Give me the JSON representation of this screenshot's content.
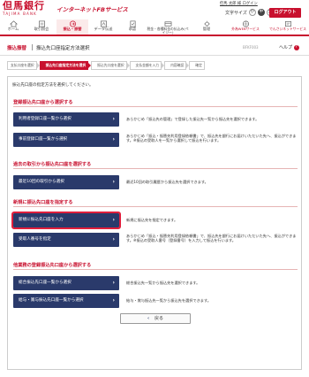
{
  "header": {
    "logo_main": "但馬銀行",
    "logo_sub": "TAJIMA BANK",
    "service_title": "インターネットFBサービス",
    "user_line": "但馬 太郎 様 ログイン",
    "font_label": "文字サイズ",
    "font_small": "小",
    "font_medium": "中",
    "font_large": "大",
    "logout_label": "ログアウト"
  },
  "nav": {
    "items": [
      {
        "label": "ホーム",
        "icon": "home-icon"
      },
      {
        "label": "取引照会",
        "icon": "inquiry-icon"
      },
      {
        "label": "振込・振替",
        "icon": "transfer-icon"
      },
      {
        "label": "データ伝送",
        "icon": "data-icon"
      },
      {
        "label": "承認",
        "icon": "approval-icon"
      },
      {
        "label": "税金・各種料金の払込み(ペイジー)",
        "icon": "payment-icon"
      },
      {
        "label": "管理",
        "icon": "admin-icon"
      },
      {
        "label": "外為WEBサービス",
        "icon": "forex-icon"
      },
      {
        "label": "でんさいネットサービス",
        "icon": "densai-icon"
      }
    ]
  },
  "title_bar": {
    "category": "振込振替",
    "title": "振込先口座指定方法選択",
    "screen_id": "BFKF003",
    "help": "ヘルプ"
  },
  "steps": [
    "支払口座を選択",
    "振込先口座指定方法を選択",
    "振込先口座を選択",
    "支払金額を入力",
    "内容確認",
    "確定"
  ],
  "intro": "振込先口座の指定方法を選択してください。",
  "sections": [
    {
      "heading": "登録振込先口座から選択する",
      "buttons": [
        {
          "label": "利用者登録口座一覧から選択",
          "desc": "あらかじめ「振込先の管理」で登録した振込先一覧から振込先を選択できます。"
        },
        {
          "label": "事前登録口座一覧から選択",
          "desc": "あらかじめ「振込・振替先利用登録依頼書」で、振込先を銀行にお届けいただいた先へ、振込ができます。※振込の受取人を一覧から選択して振込を行います。"
        }
      ]
    },
    {
      "heading": "過去の取引から振込先口座を選択する",
      "buttons": [
        {
          "label": "最近10回の取引から選択",
          "desc": "最近10回の取引履歴から振込先を選択できます。"
        }
      ]
    },
    {
      "heading": "新規に振込先口座を指定する",
      "buttons": [
        {
          "label": "新規に振込先口座を入力",
          "desc": "新規に振込先を指定できます。"
        },
        {
          "label": "受取人番号を指定",
          "desc": "あらかじめ「振込・振替先利用登録依頼書」で、振込先を銀行にお届けいただいた先へ、振込ができます。※振込の受取人番号（登録番号）を入力して振込を行います。"
        }
      ]
    },
    {
      "heading": "他業務の登録振込先口座から選択する",
      "buttons": [
        {
          "label": "総合振込先口座一覧から選択",
          "desc": "総合振込先一覧から振込先を選択できます。"
        },
        {
          "label": "給与・賞与振込先口座一覧から選択",
          "desc": "給与・賞与振込先一覧から振込先を選択できます。"
        }
      ]
    }
  ],
  "back_label": "戻る"
}
